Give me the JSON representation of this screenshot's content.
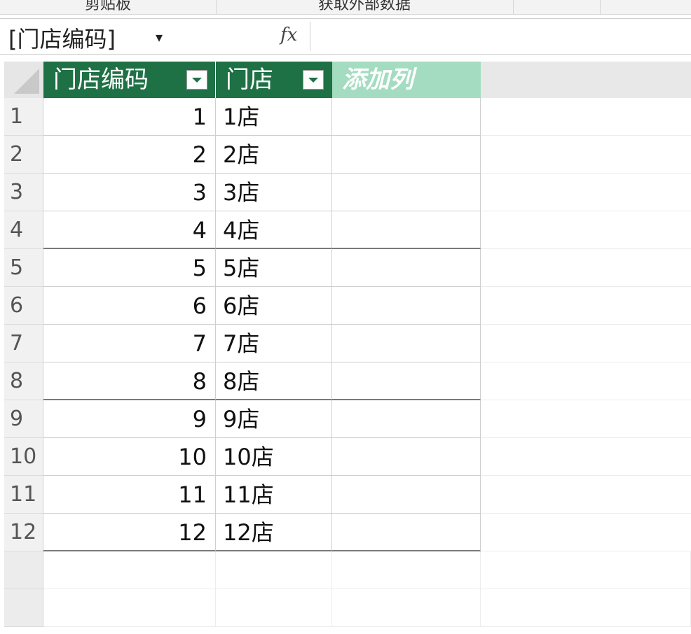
{
  "ribbon": {
    "groups": [
      "剪贴板",
      "获取外部数据",
      "",
      ""
    ]
  },
  "formula_bar": {
    "name_box": "[门店编码]",
    "fx_label": "fx",
    "formula": ""
  },
  "table": {
    "columns": [
      {
        "label": "门店编码"
      },
      {
        "label": "门店"
      },
      {
        "label": "添加列"
      }
    ],
    "rows": [
      {
        "num": "1",
        "code": "1",
        "store": "1店"
      },
      {
        "num": "2",
        "code": "2",
        "store": "2店"
      },
      {
        "num": "3",
        "code": "3",
        "store": "3店"
      },
      {
        "num": "4",
        "code": "4",
        "store": "4店"
      },
      {
        "num": "5",
        "code": "5",
        "store": "5店"
      },
      {
        "num": "6",
        "code": "6",
        "store": "6店"
      },
      {
        "num": "7",
        "code": "7",
        "store": "7店"
      },
      {
        "num": "8",
        "code": "8",
        "store": "8店"
      },
      {
        "num": "9",
        "code": "9",
        "store": "9店"
      },
      {
        "num": "10",
        "code": "10",
        "store": "10店"
      },
      {
        "num": "11",
        "code": "11",
        "store": "11店"
      },
      {
        "num": "12",
        "code": "12",
        "store": "12店"
      }
    ]
  },
  "colors": {
    "header_green": "#1e7145",
    "add_column_green": "#a3dcc0"
  }
}
